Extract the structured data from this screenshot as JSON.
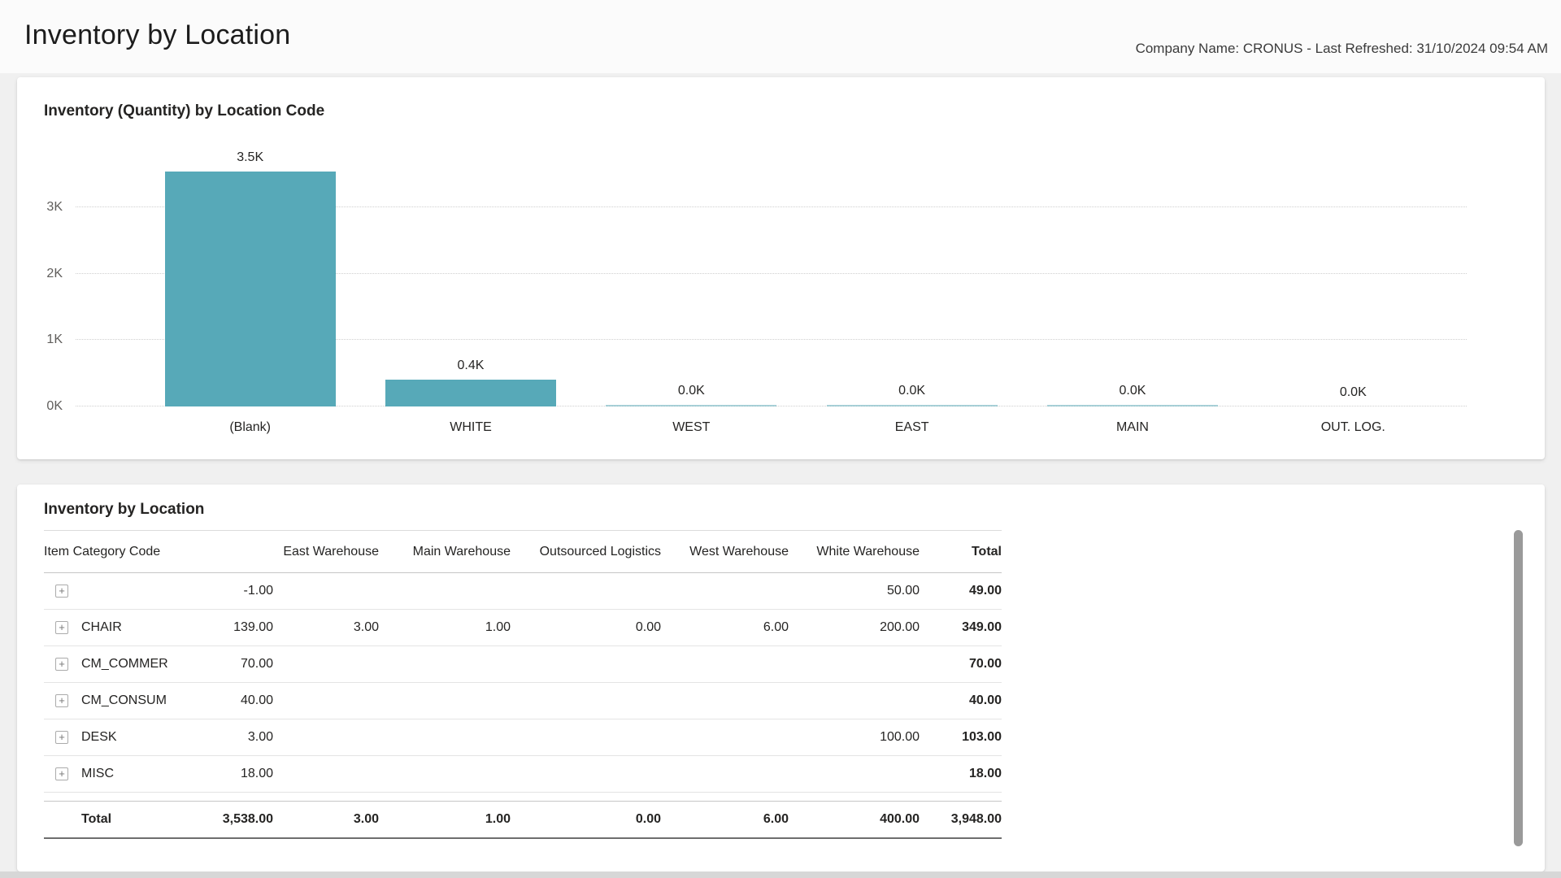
{
  "header": {
    "title": "Inventory by Location",
    "meta": "Company Name: CRONUS - Last Refreshed: 31/10/2024 09:54 AM"
  },
  "chart_card": {
    "title": "Inventory (Quantity) by Location Code"
  },
  "chart_data": {
    "type": "bar",
    "title": "Inventory (Quantity) by Location Code",
    "categories": [
      "(Blank)",
      "WHITE",
      "WEST",
      "EAST",
      "MAIN",
      "OUT. LOG."
    ],
    "values": [
      3538,
      400,
      6,
      3,
      1,
      0
    ],
    "value_labels": [
      "3.5K",
      "0.4K",
      "0.0K",
      "0.0K",
      "0.0K",
      "0.0K"
    ],
    "ytick_labels": [
      "0K",
      "1K",
      "2K",
      "3K"
    ],
    "ytick_values": [
      0,
      1000,
      2000,
      3000
    ],
    "ylim": [
      0,
      3500
    ],
    "bar_color": "#57A9B8",
    "grid": "dotted-horizontal",
    "legend": "none"
  },
  "table_card": {
    "title": "Inventory by Location",
    "columns": [
      "Item Category Code",
      "",
      "East Warehouse",
      "Main Warehouse",
      "Outsourced Logistics",
      "West Warehouse",
      "White Warehouse",
      "Total"
    ],
    "rows": [
      {
        "category": "",
        "values": [
          "-1.00",
          "",
          "",
          "",
          "",
          "50.00",
          "49.00"
        ]
      },
      {
        "category": "CHAIR",
        "values": [
          "139.00",
          "3.00",
          "1.00",
          "0.00",
          "6.00",
          "200.00",
          "349.00"
        ]
      },
      {
        "category": "CM_COMMER",
        "values": [
          "70.00",
          "",
          "",
          "",
          "",
          "",
          "70.00"
        ]
      },
      {
        "category": "CM_CONSUM",
        "values": [
          "40.00",
          "",
          "",
          "",
          "",
          "",
          "40.00"
        ]
      },
      {
        "category": "DESK",
        "values": [
          "3.00",
          "",
          "",
          "",
          "",
          "100.00",
          "103.00"
        ]
      },
      {
        "category": "MISC",
        "values": [
          "18.00",
          "",
          "",
          "",
          "",
          "",
          "18.00"
        ]
      }
    ],
    "total_row": {
      "category": "Total",
      "values": [
        "3,538.00",
        "3.00",
        "1.00",
        "0.00",
        "6.00",
        "400.00",
        "3,948.00"
      ]
    }
  },
  "icons": {
    "expand": "+"
  }
}
